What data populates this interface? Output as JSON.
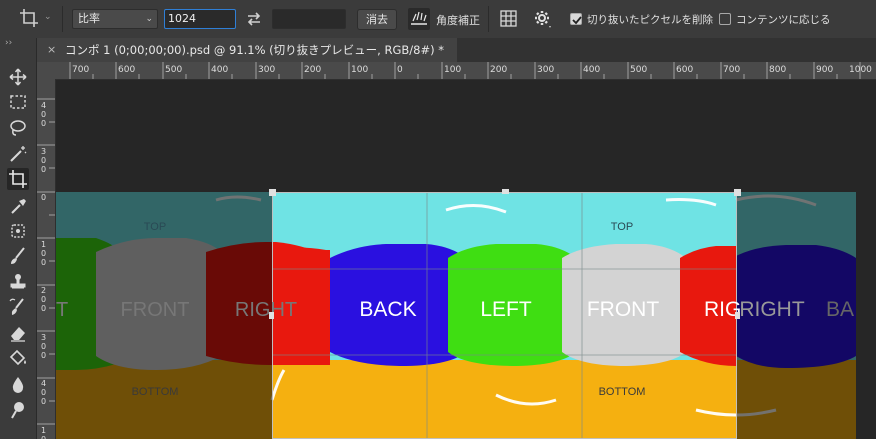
{
  "options_bar": {
    "ratio_preset": "比率",
    "width_value": "1024",
    "height_value": "",
    "clear_label": "消去",
    "straighten_label": "角度補正",
    "delete_cropped_label": "切り抜いたピクセルを削除",
    "delete_cropped_checked": true,
    "content_aware_label": "コンテンツに応じる",
    "content_aware_checked": false
  },
  "toolbox": {
    "collapse_glyph": "››",
    "tools": [
      "move-icon",
      "marquee-icon",
      "lasso-icon",
      "magic-wand-icon",
      "crop-icon",
      "eyedropper-icon",
      "patch-icon",
      "brush-icon",
      "stamp-icon",
      "history-brush-icon",
      "eraser-icon",
      "paint-bucket-icon",
      "blur-icon",
      "dodge-icon"
    ],
    "active_tool": "crop-icon"
  },
  "document_tab": {
    "close_glyph": "×",
    "title": "コンポ 1 (0;00;00;00).psd @ 91.1% (切り抜きプレビュー, RGB/8#) *"
  },
  "ruler_top": [
    "700",
    "600",
    "500",
    "400",
    "300",
    "200",
    "100",
    "0",
    "100",
    "200",
    "300",
    "400",
    "500",
    "600",
    "700",
    "800",
    "900",
    "1000"
  ],
  "ruler_left": [
    "0",
    "1 0 0",
    "2 0 0",
    "3 0 0",
    "4 0 0",
    "1 0 0",
    "2 0 0",
    "3 0 0",
    "4 0 0"
  ],
  "canvas": {
    "face_labels": {
      "top": "TOP",
      "bottom": "BOTTOM",
      "front": "FRONT",
      "back": "BACK",
      "left": "LEFT",
      "right": "RIGHT",
      "right_partial": "RIG",
      "back_partial": "BA",
      "front_partial": "T"
    },
    "colors": {
      "sky": "#6fe3e4",
      "top_band": "#5aa8b2",
      "floor": "#f5b010",
      "red": "#e8180e",
      "blue": "#2a10e0",
      "green": "#3fde12",
      "grey": "#d3d3d3",
      "background": "#262626"
    }
  }
}
